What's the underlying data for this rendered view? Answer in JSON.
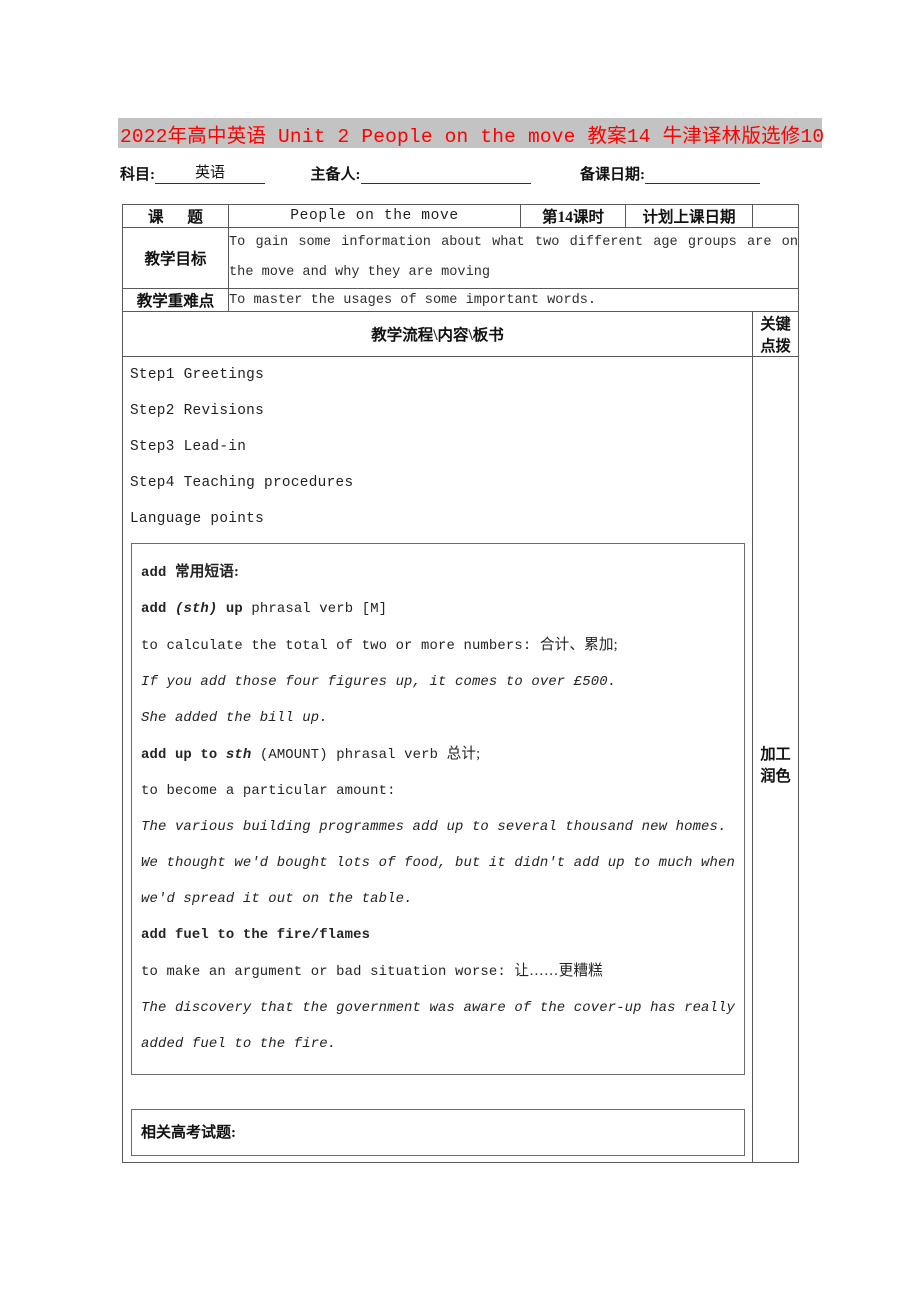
{
  "document": {
    "title": "2022年高中英语 Unit 2 People on  the  move 教案14 牛津译林版选修10",
    "title_color": "#ff0000",
    "title_highlight": "#c3c3c3"
  },
  "meta": {
    "subject_label": "科目:",
    "subject_value": "英语",
    "author_label": "主备人:",
    "author_value": "",
    "date_label": "备课日期:",
    "date_value": ""
  },
  "table": {
    "row_topic": {
      "label": "课    题",
      "title": "People on the move",
      "period": "第14课时",
      "plan_label": "计划上课日期",
      "plan_value": ""
    },
    "row_goal": {
      "label": "教学目标",
      "text": "To gain some information about what two different age groups are on the move and why they are moving"
    },
    "row_focus": {
      "label": "教学重难点",
      "text": "To master the usages of some important words."
    },
    "row_flow": {
      "header": "教学流程\\内容\\板书",
      "side_header": "关键点拨",
      "side_note": "加工润色"
    }
  },
  "steps": [
    "Step1 Greetings",
    "Step2 Revisions",
    "Step3 Lead-in",
    "Step4 Teaching procedures",
    "Language points"
  ],
  "notebox": {
    "heading_en": "add",
    "heading_cn": "常用短语:",
    "entry1": {
      "term_a": "add",
      "term_b": "(sth)",
      "term_c": "up",
      "pos": "phrasal verb [M]",
      "def": "to calculate the total of two or more numbers:",
      "def_cn": "合计、累加;",
      "ex1": "If you add those four figures up, it comes to over £500.",
      "ex2": "She added the bill up."
    },
    "entry2": {
      "term_a": "add up to",
      "term_b": "sth",
      "amount": "(AMOUNT)",
      "pos": "phrasal verb",
      "pos_cn": "总计;",
      "def": "to become a particular amount:",
      "ex1": "The various building programmes add up to several thousand new homes.",
      "ex2": "We thought we'd bought lots of food, but it didn't add up to much when we'd spread it out on the table."
    },
    "entry3": {
      "term": "add fuel to the fire/flames",
      "def": "to make an argument or bad situation worse:",
      "def_cn": "让……更糟糕",
      "ex1": "The discovery that the government was aware of the cover-up has really added fuel to the fire."
    }
  },
  "notebox2": {
    "heading": "相关高考试题:"
  }
}
